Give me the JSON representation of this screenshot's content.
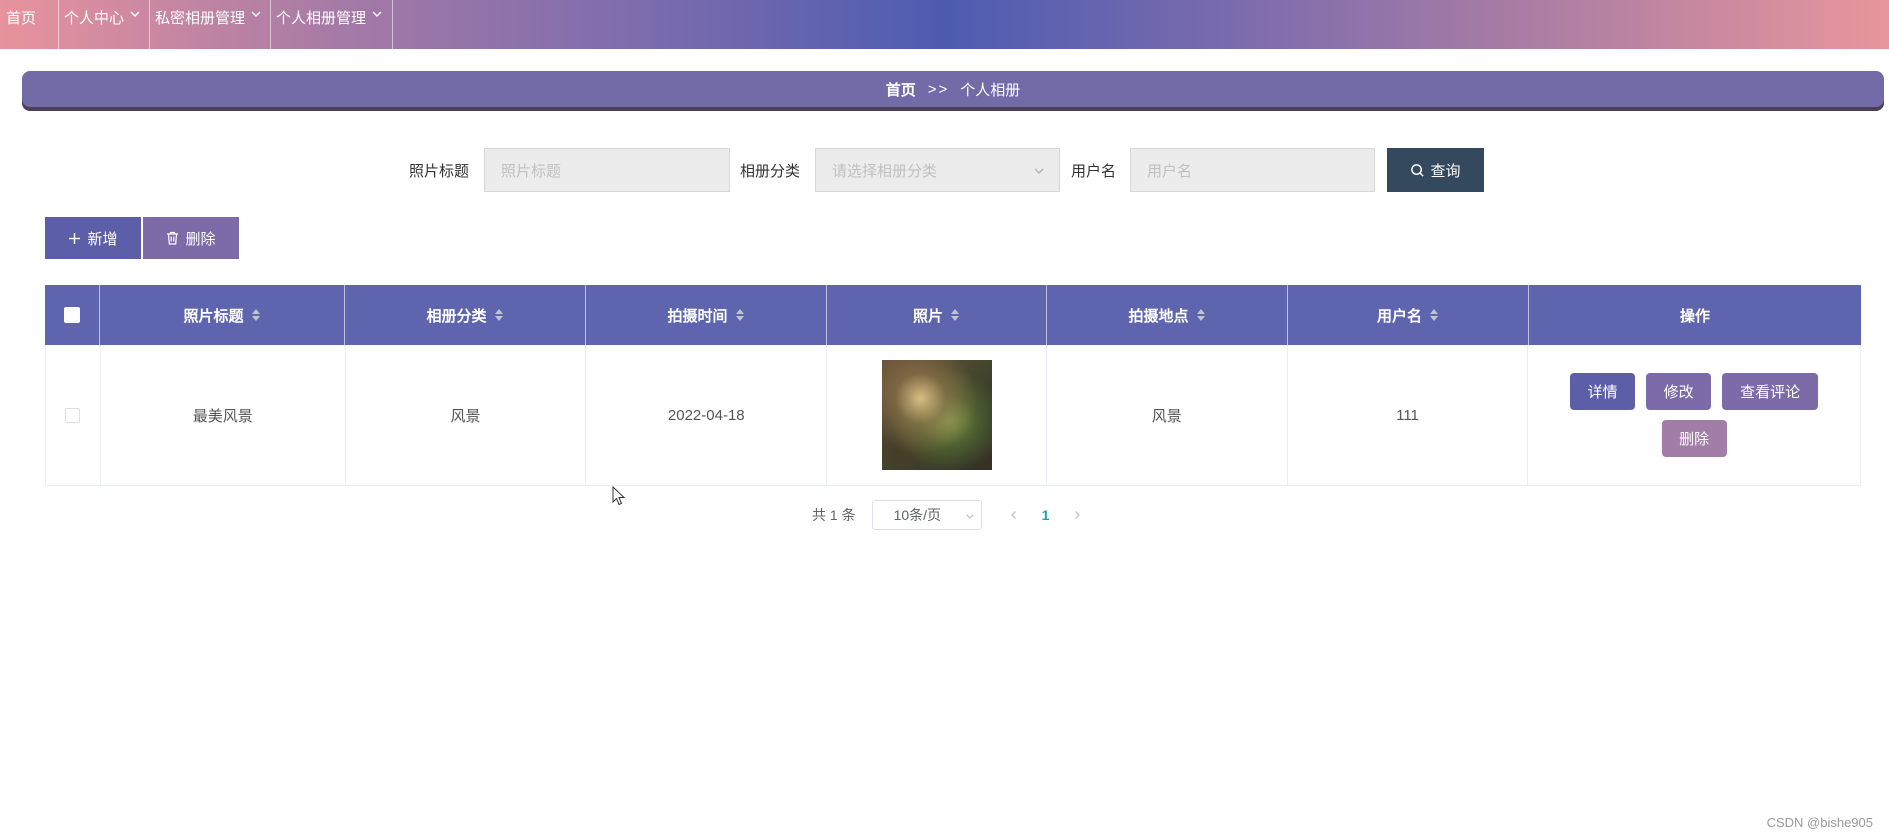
{
  "nav": {
    "items": [
      {
        "label": "首页",
        "has_dropdown": false
      },
      {
        "label": "个人中心",
        "has_dropdown": true
      },
      {
        "label": "私密相册管理",
        "has_dropdown": true
      },
      {
        "label": "个人相册管理",
        "has_dropdown": true
      }
    ]
  },
  "breadcrumb": {
    "home": "首页",
    "separator": ">>",
    "current": "个人相册"
  },
  "search": {
    "title_label": "照片标题",
    "title_placeholder": "照片标题",
    "category_label": "相册分类",
    "category_placeholder": "请选择相册分类",
    "username_label": "用户名",
    "username_placeholder": "用户名",
    "query_button": "查询"
  },
  "actions": {
    "add_label": "新增",
    "delete_label": "删除"
  },
  "table": {
    "headers": [
      "照片标题",
      "相册分类",
      "拍摄时间",
      "照片",
      "拍摄地点",
      "用户名",
      "操作"
    ],
    "rows": [
      {
        "title": "最美风景",
        "category": "风景",
        "date": "2022-04-18",
        "photo": "photo-thumbnail",
        "location": "风景",
        "username": "111"
      }
    ],
    "row_actions": {
      "detail": "详情",
      "edit": "修改",
      "comments": "查看评论",
      "delete": "删除"
    }
  },
  "pagination": {
    "total": "共 1 条",
    "page_size": "10条/页",
    "current_page": "1"
  },
  "watermark": "CSDN @bishe905",
  "colors": {
    "primary": "#5e64ad",
    "secondary": "#7c6ba8",
    "query": "#34485e",
    "page_active": "#17a2b8"
  }
}
